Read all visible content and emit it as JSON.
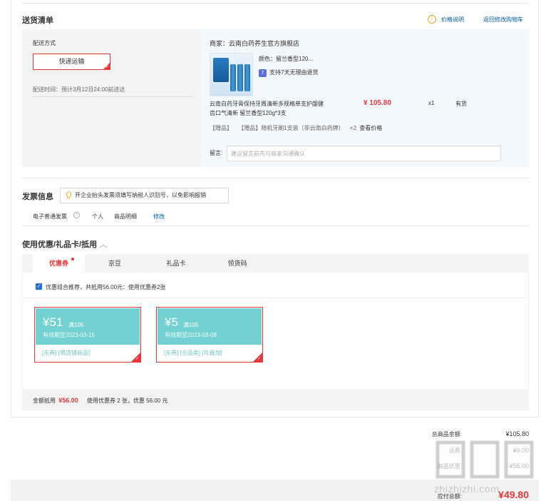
{
  "delivery": {
    "title": "送货清单",
    "price_info_icon": "!",
    "price_info": "价格说明",
    "back_link": "返回修改购物车",
    "shipping_label": "配送方式",
    "shipping_button": "快递运输",
    "shipping_time": "配送时间：预计3月12日24:00前送达",
    "merchant": "商家：云南白药养生官方旗舰店",
    "product": {
      "color": "颜色：留兰香型120...",
      "return_badge": "7",
      "return_policy": "支持7天无理由退货",
      "name_line1": "云南白药牙膏保持牙周清新多规格单支护龈健",
      "name_line2": "齿口气清新 留兰香型120g*3支",
      "price": "¥ 105.80",
      "qty": "x1",
      "stock": "有货",
      "gift_tag": "【赠品】",
      "gift_desc": "【赠品】随机牙刷1支装（非云南白药牌）",
      "gift_qty": "×2",
      "gift_link": "查看价格"
    },
    "note_label": "留言:",
    "note_placeholder": "建议留言前先与商家沟通确认"
  },
  "invoice": {
    "title": "发票信息",
    "tip": "开企业抬头发票须填写纳税人识别号，以免影响报销",
    "type": "电子普通发票",
    "info_icon": "i",
    "payer": "个人",
    "content": "商品明细",
    "edit": "修改"
  },
  "coupons": {
    "title": "使用优惠/礼品卡/抵用",
    "tabs": [
      "优惠券",
      "京豆",
      "礼品卡",
      "领货码"
    ],
    "recommend": "优惠组合推荐，共抵用56.00元：使用优惠券2张",
    "items": [
      {
        "amount": "¥51",
        "condition": "满105",
        "expiry": "有效期至2023-03-15",
        "tags": "[东券] [限店铺商品]"
      },
      {
        "amount": "¥5",
        "condition": "满105",
        "expiry": "有效期至2023-03-08",
        "tags": "[东券] [全品类] [可叠加]"
      }
    ],
    "summary_label": "金额抵用",
    "summary_amount": "¥56.00",
    "summary_desc": "使用优惠券 2 张，优惠 56.00 元"
  },
  "totals": {
    "goods_label": "总商品金额:",
    "goods_value": "¥105.80",
    "row2_label": "运费:",
    "row2_value": "¥0.00",
    "row3_label": "商品优惠:",
    "row3_value": "-¥56.00",
    "payable_label": "应付总额:",
    "payable_value": "¥49.80"
  },
  "watermark": "zhizhizhi.com",
  "colors": {
    "accent": "#e4393c",
    "link": "#005ea7",
    "coupon": "#74d1d1"
  }
}
